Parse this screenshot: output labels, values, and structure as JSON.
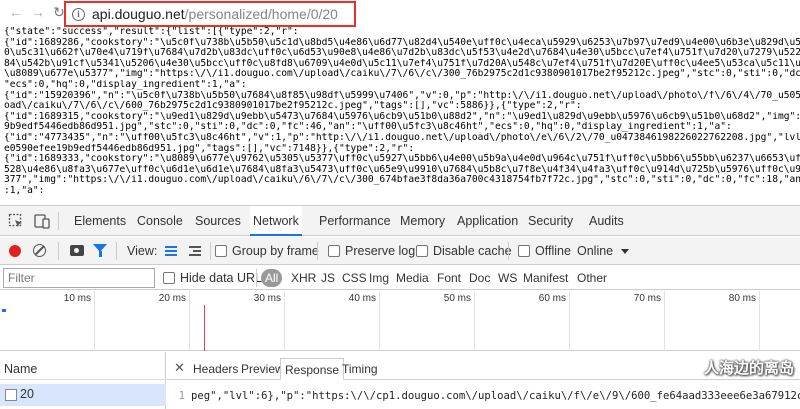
{
  "address_bar": {
    "host": "api.douguo.net",
    "path": "/personalized/home/0/20"
  },
  "json_lines": [
    "{\"state\":\"success\",\"result\":{\"list\":[{\"type\":2,\"r\":",
    "{\"id\":1689286,\"cookstory\":\"\\u5c0f\\u738b\\u5b50\\u5c1d\\u8bd5\\u4e86\\u6d77\\u82d4\\u540e\\uff0c\\u4eca\\u5929\\u6253\\u7b97\\u7ed9\\u4e00\\u6b3e\\u829d\\u58eb\\u6d77\\u82d4",
    "0\\u5c31\\u662f\\u70e4\\u719f\\u7684\\u7d2b\\u83dc\\uff0c\\u6d53\\u90e8\\u4e86\\u7d2b\\u83dc\\u5f53\\u4e2d\\u7684\\u4e30\\u5bcc\\u7ef4\\u751f\\u7d20\\u7279\\u522b\\u662f\\u6d77",
    "84\\u542b\\u91cf\\u5341\\u5206\\u4e30\\u5bcc\\uff0c\\u8fd8\\u6709\\u4e0d\\u5c11\\u7ef4\\u751f\\u7d20A\\u548c\\u7ef4\\u751f\\u7d20E\\uff0c\\u4ee5\\u53ca\\u5c11\\u91cf\\u7684\\u7ef4\\u751f\\u7d20",
    "\\u8089\\u677e\\u5377\",\"img\":\"https:\\/\\/i1.douguo.com\\/upload\\/caiku\\/7\\/6\\/c\\/300_76b2975c2d1c9380901017be2f95212c.jpeg\",\"stc\":0,\"sti\":0,\"dc\":0,\"fc\":43,\"an\":\"\\u5c0f\\u738b",
    "\"ecs\":0,\"hq\":0,\"display_ingredient\":1,\"a\":",
    "{\"id\":\"15920396\",\"n\":\"\\u5c0f\\u738b\\u5b50\\u7684\\u8f85\\u98df\\u5999\\u7406\",\"v\":0,\"p\":\"http:\\/\\/i1.douguo.net\\/upload\\/photo\\/f\\/6\\/4\\/70_u50522343258515000810.jpeg\",\"l",
    "oad\\/caiku\\/7\\/6\\/c\\/600_76b2975c2d1c9380901017be2f95212c.jpeg\",\"tags\":[],\"vc\":5886}},{\"type\":2,\"r\":",
    "{\"id\":1689315,\"cookstory\":\"\\u9ed1\\u829d\\u9ebb\\u5473\\u7684\\u5976\\u6cb9\\u51b0\\u88d2\",\"n\":\"\\u9ed1\\u829d\\u9ebb\\u5976\\u6cb9\\u51b0\\u68d2\",\"img\":\"https:\\/\\/i1.douguo.com\\/",
    "9b9edf5446edb86d951.jpg\",\"stc\":0,\"sti\":0,\"dc\":0,\"fc\":46,\"an\":\"\\uff00\\u5fc3\\u8c46ht\",\"ecs\":0,\"hq\":0,\"display_ingredient\":1,\"a\":",
    "{\"id\":\"4773435\",\"n\":\"\\uff00\\u5fc3\\u8c46ht\",\"v\":1,\"p\":\"http:\\/\\/i1.douguo.net\\/upload\\/photo\\/e\\/6\\/2\\/70_u0473846198226022762208.jpg\",\"lvl\":6},\"p\":\"https:\\/\\/cp1.do",
    "e0590efee19b9edf5446edb86d951.jpg\",\"tags\":[],\"vc\":7148}},{\"type\":2,\"r\":",
    "{\"id\":1689333,\"cookstory\":\"\\u8089\\u677e\\u9762\\u5305\\u5377\\uff0c\\u5927\\u5bb6\\u4e00\\u5b9a\\u4e0d\\u964c\\u751f\\uff0c\\u5bb6\\u55bb\\u6237\\u6653\\uff0c\\u54b8\\u751c\\u597d\\u5403",
    "528\\u4e86\\u8fa3\\u677e\\uff0c\\u6d1e\\u6d1e\\u7684\\u8fa3\\u5473\\uff0c\\u65e9\\u9910\\u7684\\u5b8c\\u7f8e\\u4f34\\u4fa3\\uff0c\\u914d\\u725b\\u5976\\uff0c\\u914d\\u7ca5\\u90fd\\u53ef\\u4ee5",
    "377\",\"img\":\"https:\\/\\/i1.douguo.com\\/upload\\/caiku\\/6\\/7\\/c\\/300_674bfae3f8da36a700c4318754fb7f72c.jpg\",\"stc\":0,\"sti\":0,\"dc\":0,\"fc\":18,\"an\":\"\\u5c16\\u5c16\\u5b9e\\u9a8c",
    ":1,\"a\":"
  ],
  "devtools": {
    "tabs": [
      "Elements",
      "Console",
      "Sources",
      "Network",
      "Performance",
      "Memory",
      "Application",
      "Security",
      "Audits"
    ],
    "active_tab": "Network",
    "toolbar": {
      "view_label": "View:",
      "group_by_frame": "Group by frame",
      "preserve_log": "Preserve log",
      "disable_cache": "Disable cache",
      "offline": "Offline",
      "throttle": "Online"
    },
    "filter": {
      "placeholder": "Filter",
      "hide_data_urls": "Hide data URLs",
      "types": [
        "All",
        "XHR",
        "JS",
        "CSS",
        "Img",
        "Media",
        "Font",
        "Doc",
        "WS",
        "Manifest",
        "Other"
      ],
      "active_type": "All"
    },
    "timeline_ticks": [
      "10 ms",
      "20 ms",
      "30 ms",
      "40 ms",
      "50 ms",
      "60 ms",
      "70 ms",
      "80 ms"
    ],
    "name_header": "Name",
    "requests": [
      {
        "name": "20"
      }
    ],
    "detail_tabs": [
      "Headers",
      "Preview",
      "Response",
      "Timing"
    ],
    "active_detail_tab": "Response",
    "response_line_no": "1",
    "response_line": "peg\",\"lvl\":6},\"p\":\"https:\\/\\/cp1.douguo.com\\/upload\\/caiku\\/f\\/e\\/9\\/600_fe64aad333eee6e3a67912cb6768"
  },
  "watermark": "人海边的离岛",
  "colors": {
    "highlight_box": "#e8302a",
    "accent": "#1a73e8",
    "record": "#e0201a",
    "selected_row": "#d8e6fd"
  }
}
